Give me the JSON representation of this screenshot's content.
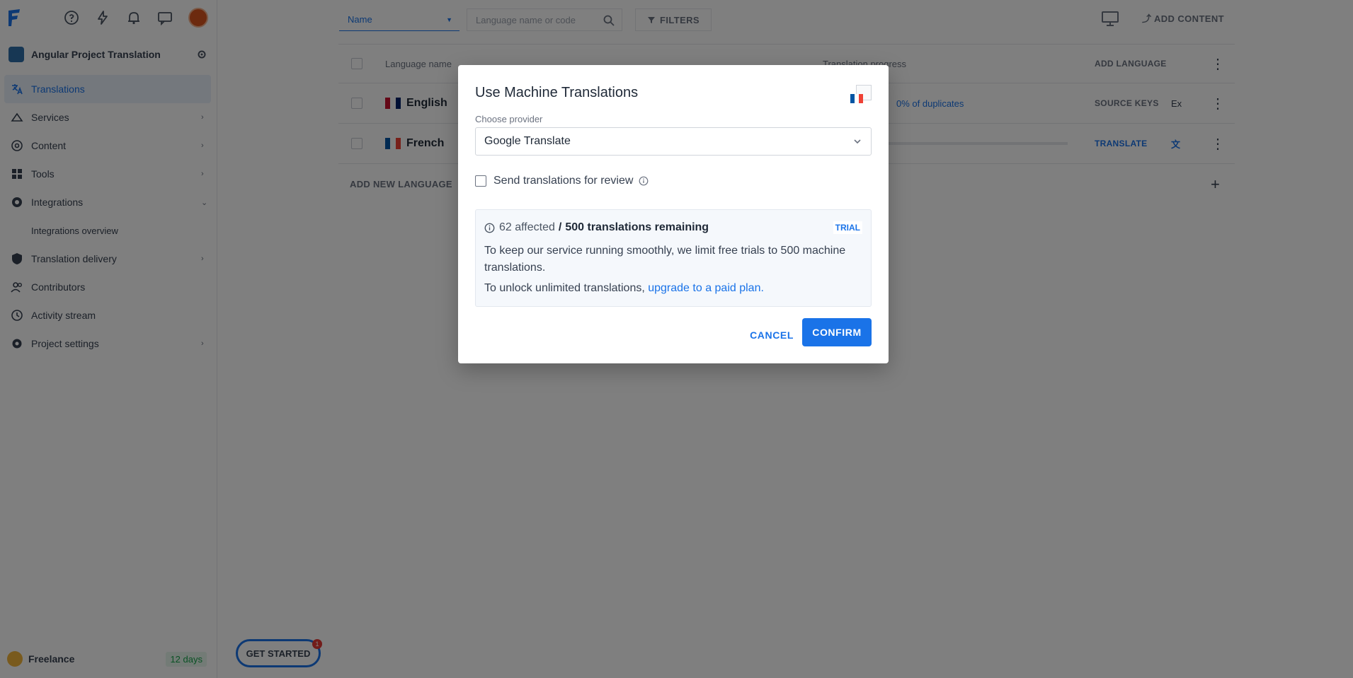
{
  "sidebar": {
    "project_name": "Angular Project Translation",
    "items": [
      {
        "label": "Translations"
      },
      {
        "label": "Services"
      },
      {
        "label": "Content"
      },
      {
        "label": "Tools"
      },
      {
        "label": "Integrations"
      },
      {
        "label": "Integrations overview"
      },
      {
        "label": "Translation delivery"
      },
      {
        "label": "Contributors"
      },
      {
        "label": "Activity stream"
      },
      {
        "label": "Project settings"
      }
    ],
    "plan": {
      "name": "Freelance",
      "days": "12 days"
    },
    "get_started": "GET STARTED",
    "get_started_count": "1"
  },
  "header": {
    "sort_value": "Name",
    "search_placeholder": "Language name or code",
    "filters_label": "FILTERS",
    "add_content_label": "ADD CONTENT"
  },
  "table": {
    "headers": {
      "name": "Language name",
      "progress": "Translation progress",
      "add_language": "ADD LANGUAGE"
    },
    "rows": [
      {
        "name": "English",
        "extra": "0% of duplicates",
        "action": "SOURCE KEYS",
        "col": "Ex"
      },
      {
        "name": "French",
        "action": "TRANSLATE"
      }
    ],
    "add_new_label": "ADD NEW LANGUAGE"
  },
  "modal": {
    "title": "Use Machine Translations",
    "provider_label": "Choose provider",
    "provider_value": "Google Translate",
    "review_label": "Send translations for review",
    "affected": "62 affected",
    "remaining": "500 translations remaining",
    "trial_badge": "TRIAL",
    "info_text": "To keep our service running smoothly, we limit free trials to 500 machine translations.",
    "unlock_text": "To unlock unlimited translations,",
    "upgrade_link": "upgrade to a paid plan.",
    "cancel_label": "CANCEL",
    "confirm_label": "CONFIRM"
  },
  "colors": {
    "accent": "#1a73e8",
    "overlay": "rgba(0,0,0,0.5)"
  }
}
